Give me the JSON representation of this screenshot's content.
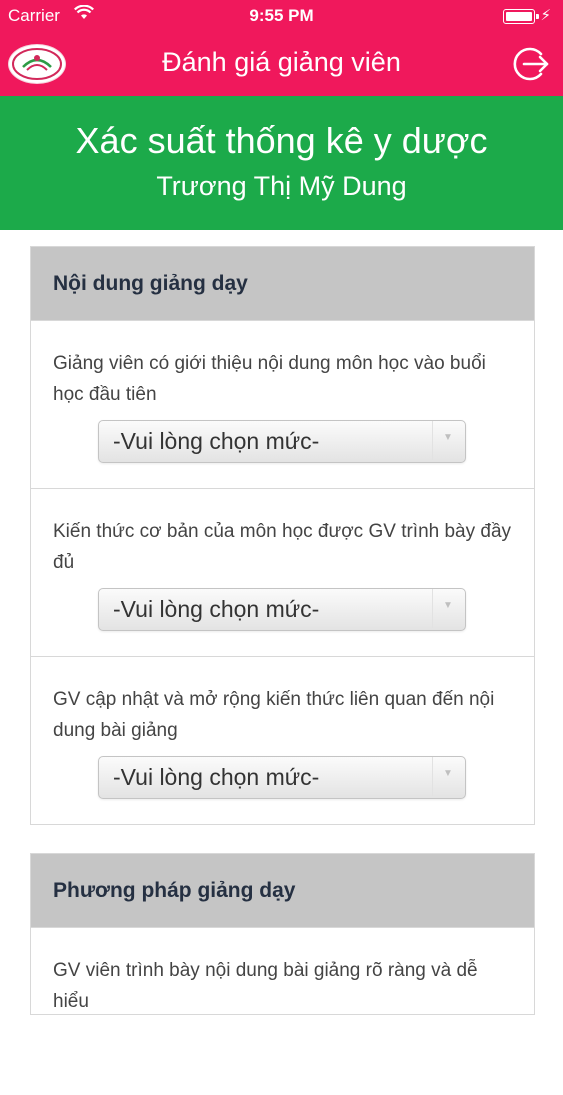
{
  "status_bar": {
    "carrier": "Carrier",
    "time": "9:55 PM"
  },
  "nav": {
    "title": "Đánh giá giảng viên"
  },
  "course": {
    "title": "Xác suất thống kê y dược",
    "lecturer": "Trương Thị Mỹ Dung"
  },
  "sections": [
    {
      "title": "Nội dung giảng dạy",
      "questions": [
        {
          "text": "Giảng viên có giới thiệu nội dung môn học vào buổi học đầu tiên",
          "select_value": "-Vui lòng chọn mức-"
        },
        {
          "text": "Kiến thức cơ bản của môn học được GV trình bày đầy đủ",
          "select_value": "-Vui lòng chọn mức-"
        },
        {
          "text": "GV cập nhật và mở rộng kiến thức liên quan đến nội dung bài giảng",
          "select_value": "-Vui lòng chọn mức-"
        }
      ]
    },
    {
      "title": "Phương pháp giảng dạy",
      "questions": [
        {
          "text": "GV viên trình bày nội dung bài giảng rõ ràng và dễ hiểu"
        }
      ]
    }
  ],
  "colors": {
    "brand_pink": "#f0185c",
    "header_green": "#1caa4a",
    "section_gray": "#c5c5c5"
  },
  "icons": [
    "wifi-icon",
    "battery-icon",
    "charging-icon",
    "app-logo",
    "logout-icon",
    "dropdown-arrow-icon"
  ]
}
